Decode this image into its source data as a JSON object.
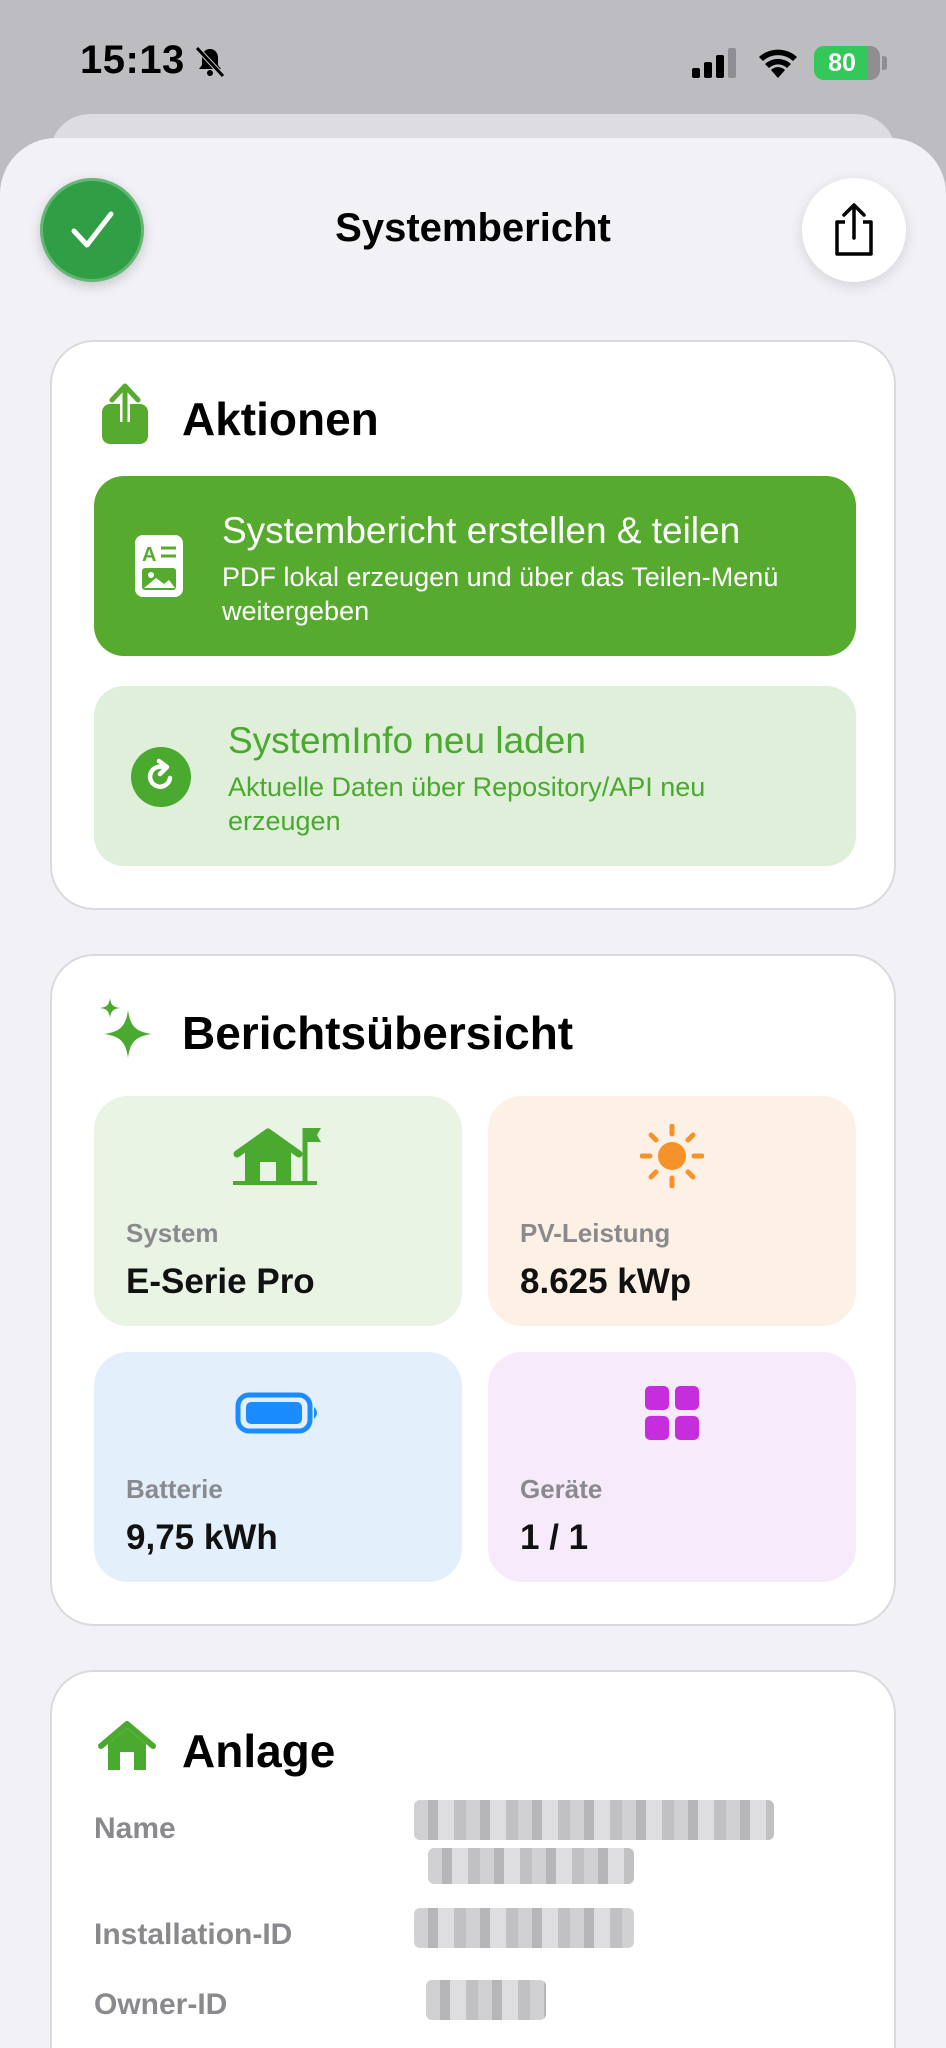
{
  "status_bar": {
    "time": "15:13",
    "battery_percent": "80",
    "battery_level": 0.8
  },
  "header": {
    "title": "Systembericht",
    "done_icon": "checkmark-icon",
    "share_icon": "share-icon"
  },
  "actions": {
    "title": "Aktionen",
    "icon": "share-upload-icon",
    "primary": {
      "title": "Systembericht erstellen & teilen",
      "subtitle": "PDF lokal erzeugen und über das Teilen-Menü weitergeben",
      "icon": "document-icon"
    },
    "secondary": {
      "title": "SystemInfo neu laden",
      "subtitle": "Aktuelle Daten über Repository/API neu erzeugen",
      "icon": "reload-icon"
    }
  },
  "overview": {
    "title": "Berichtsübersicht",
    "icon": "sparkles-icon",
    "tiles": [
      {
        "label": "System",
        "value": "E-Serie Pro",
        "icon": "house-flag-icon",
        "color": "#e9f4e4"
      },
      {
        "label": "PV-Leistung",
        "value": "8.625 kWp",
        "icon": "sun-icon",
        "color": "#fdf1e5"
      },
      {
        "label": "Batterie",
        "value": "9,75 kWh",
        "icon": "battery-icon",
        "color": "#e3f0fc"
      },
      {
        "label": "Geräte",
        "value": "1 / 1",
        "icon": "grid-icon",
        "color": "#f7ebfb"
      }
    ]
  },
  "installation": {
    "title": "Anlage",
    "icon": "house-icon",
    "fields": [
      {
        "label": "Name"
      },
      {
        "label": "Installation-ID"
      },
      {
        "label": "Owner-ID"
      }
    ]
  },
  "colors": {
    "accent_green": "#56ab2f",
    "light_green": "#dfefda",
    "done_green": "#2f9e44",
    "sun_orange": "#f5922a",
    "battery_blue": "#1a8cff",
    "grid_purple": "#c62ddc"
  }
}
